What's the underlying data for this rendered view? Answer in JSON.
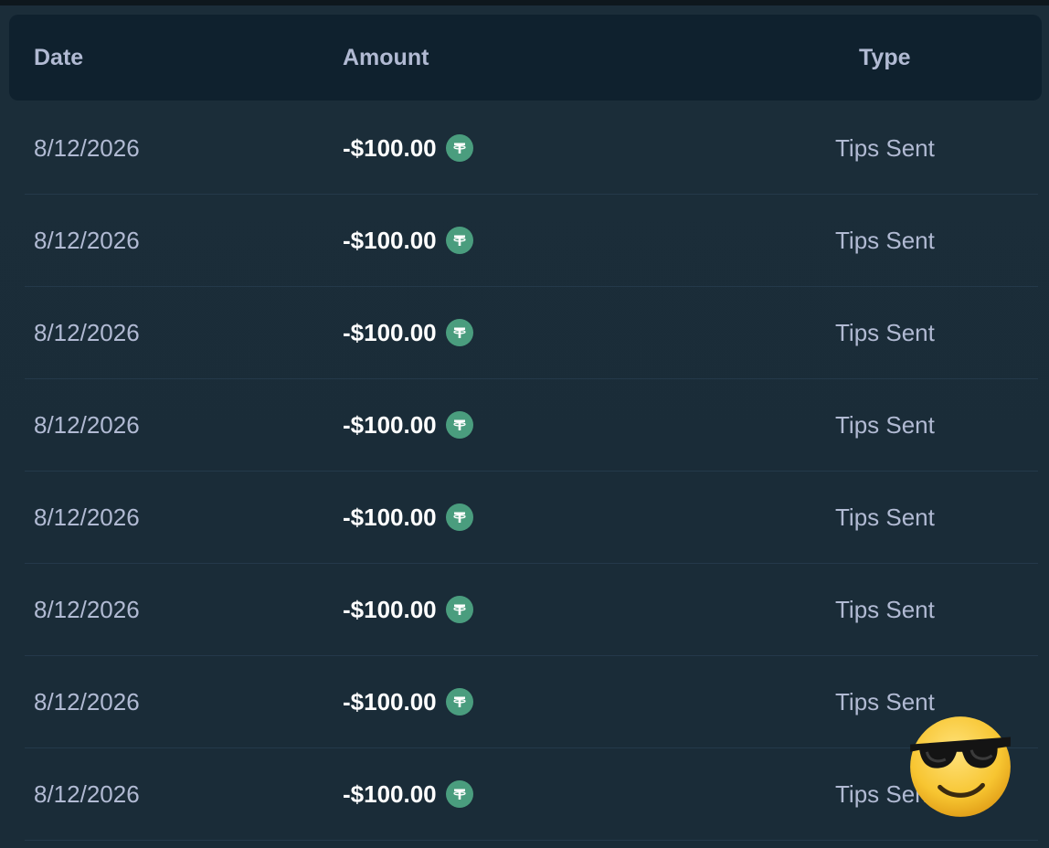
{
  "table": {
    "headers": {
      "date": "Date",
      "amount": "Amount",
      "type": "Type"
    },
    "rows": [
      {
        "date": "8/12/2026",
        "amount": "-$100.00",
        "currency_icon": "tether-usdt-icon",
        "type": "Tips Sent"
      },
      {
        "date": "8/12/2026",
        "amount": "-$100.00",
        "currency_icon": "tether-usdt-icon",
        "type": "Tips Sent"
      },
      {
        "date": "8/12/2026",
        "amount": "-$100.00",
        "currency_icon": "tether-usdt-icon",
        "type": "Tips Sent"
      },
      {
        "date": "8/12/2026",
        "amount": "-$100.00",
        "currency_icon": "tether-usdt-icon",
        "type": "Tips Sent"
      },
      {
        "date": "8/12/2026",
        "amount": "-$100.00",
        "currency_icon": "tether-usdt-icon",
        "type": "Tips Sent"
      },
      {
        "date": "8/12/2026",
        "amount": "-$100.00",
        "currency_icon": "tether-usdt-icon",
        "type": "Tips Sent"
      },
      {
        "date": "8/12/2026",
        "amount": "-$100.00",
        "currency_icon": "tether-usdt-icon",
        "type": "Tips Sent"
      },
      {
        "date": "8/12/2026",
        "amount": "-$100.00",
        "currency_icon": "tether-usdt-icon",
        "type": "Tips Sent"
      }
    ]
  },
  "overlay": {
    "emoji_icon": "sunglasses-face-emoji-icon"
  },
  "colors": {
    "background": "#1a2c38",
    "header_background": "#0f212e",
    "muted_text": "#b1bad3",
    "amount_text": "#ffffff",
    "coin": "#4a9d7e",
    "divider": "#24394a"
  }
}
